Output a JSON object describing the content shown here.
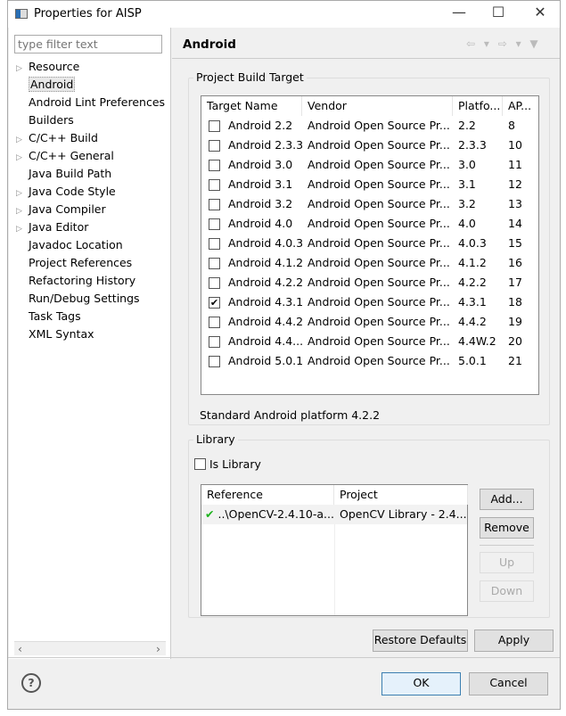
{
  "window": {
    "title": "Properties for AISP",
    "minimize": "—",
    "maximize": "☐",
    "close": "✕"
  },
  "filter": {
    "placeholder": "type filter text"
  },
  "sidebar": {
    "items": [
      {
        "label": "Resource",
        "expandable": true
      },
      {
        "label": "Android",
        "selected": true
      },
      {
        "label": "Android Lint Preferences"
      },
      {
        "label": "Builders"
      },
      {
        "label": "C/C++ Build",
        "expandable": true
      },
      {
        "label": "C/C++ General",
        "expandable": true
      },
      {
        "label": "Java Build Path"
      },
      {
        "label": "Java Code Style",
        "expandable": true
      },
      {
        "label": "Java Compiler",
        "expandable": true
      },
      {
        "label": "Java Editor",
        "expandable": true
      },
      {
        "label": "Javadoc Location"
      },
      {
        "label": "Project References"
      },
      {
        "label": "Refactoring History"
      },
      {
        "label": "Run/Debug Settings"
      },
      {
        "label": "Task Tags"
      },
      {
        "label": "XML Syntax"
      }
    ]
  },
  "page": {
    "title": "Android",
    "nav": "⇦ ▾ ⇨ ▾ ▼"
  },
  "build_target": {
    "group_label": "Project Build Target",
    "columns": [
      "Target Name",
      "Vendor",
      "Platfo...",
      "AP..."
    ],
    "rows": [
      {
        "name": "Android 2.2",
        "vendor": "Android Open Source Pr...",
        "platform": "2.2",
        "api": "8",
        "checked": false
      },
      {
        "name": "Android 2.3.3",
        "vendor": "Android Open Source Pr...",
        "platform": "2.3.3",
        "api": "10",
        "checked": false
      },
      {
        "name": "Android 3.0",
        "vendor": "Android Open Source Pr...",
        "platform": "3.0",
        "api": "11",
        "checked": false
      },
      {
        "name": "Android 3.1",
        "vendor": "Android Open Source Pr...",
        "platform": "3.1",
        "api": "12",
        "checked": false
      },
      {
        "name": "Android 3.2",
        "vendor": "Android Open Source Pr...",
        "platform": "3.2",
        "api": "13",
        "checked": false
      },
      {
        "name": "Android 4.0",
        "vendor": "Android Open Source Pr...",
        "platform": "4.0",
        "api": "14",
        "checked": false
      },
      {
        "name": "Android 4.0.3",
        "vendor": "Android Open Source Pr...",
        "platform": "4.0.3",
        "api": "15",
        "checked": false
      },
      {
        "name": "Android 4.1.2",
        "vendor": "Android Open Source Pr...",
        "platform": "4.1.2",
        "api": "16",
        "checked": false
      },
      {
        "name": "Android 4.2.2",
        "vendor": "Android Open Source Pr...",
        "platform": "4.2.2",
        "api": "17",
        "checked": false
      },
      {
        "name": "Android 4.3.1",
        "vendor": "Android Open Source Pr...",
        "platform": "4.3.1",
        "api": "18",
        "checked": true
      },
      {
        "name": "Android 4.4.2",
        "vendor": "Android Open Source Pr...",
        "platform": "4.4.2",
        "api": "19",
        "checked": false
      },
      {
        "name": "Android 4.4...",
        "vendor": "Android Open Source Pr...",
        "platform": "4.4W.2",
        "api": "20",
        "checked": false
      },
      {
        "name": "Android 5.0.1",
        "vendor": "Android Open Source Pr...",
        "platform": "5.0.1",
        "api": "21",
        "checked": false
      }
    ],
    "description": "Standard Android platform 4.2.2"
  },
  "library": {
    "group_label": "Library",
    "is_library_label": "Is Library",
    "is_library": false,
    "columns": [
      "Reference",
      "Project"
    ],
    "rows": [
      {
        "reference": "..\\OpenCV-2.4.10-a...",
        "project": "OpenCV Library - 2.4....",
        "status": "ok"
      }
    ],
    "buttons": {
      "add": "Add...",
      "remove": "Remove",
      "up": "Up",
      "down": "Down"
    }
  },
  "actions": {
    "restore_defaults": "Restore Defaults",
    "apply": "Apply",
    "ok": "OK",
    "cancel": "Cancel",
    "help": "?"
  }
}
